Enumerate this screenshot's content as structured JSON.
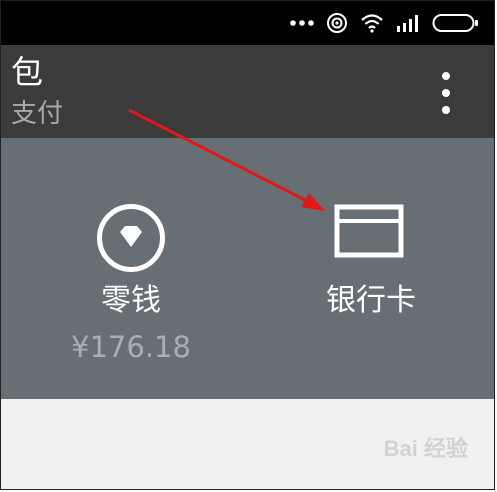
{
  "appbar": {
    "title": "包",
    "subtitle": "支付"
  },
  "wallet": {
    "change": {
      "label": "零钱",
      "value": "¥176.18",
      "icon": "diamond-icon"
    },
    "bank_card": {
      "label": "银行卡",
      "icon": "card-icon"
    }
  },
  "watermark": {
    "text": "Bai 经验"
  },
  "colors": {
    "statusbar": "#000000",
    "appbar": "#3b3b3b",
    "panel": "#676e74",
    "arrow": "#e01818"
  }
}
